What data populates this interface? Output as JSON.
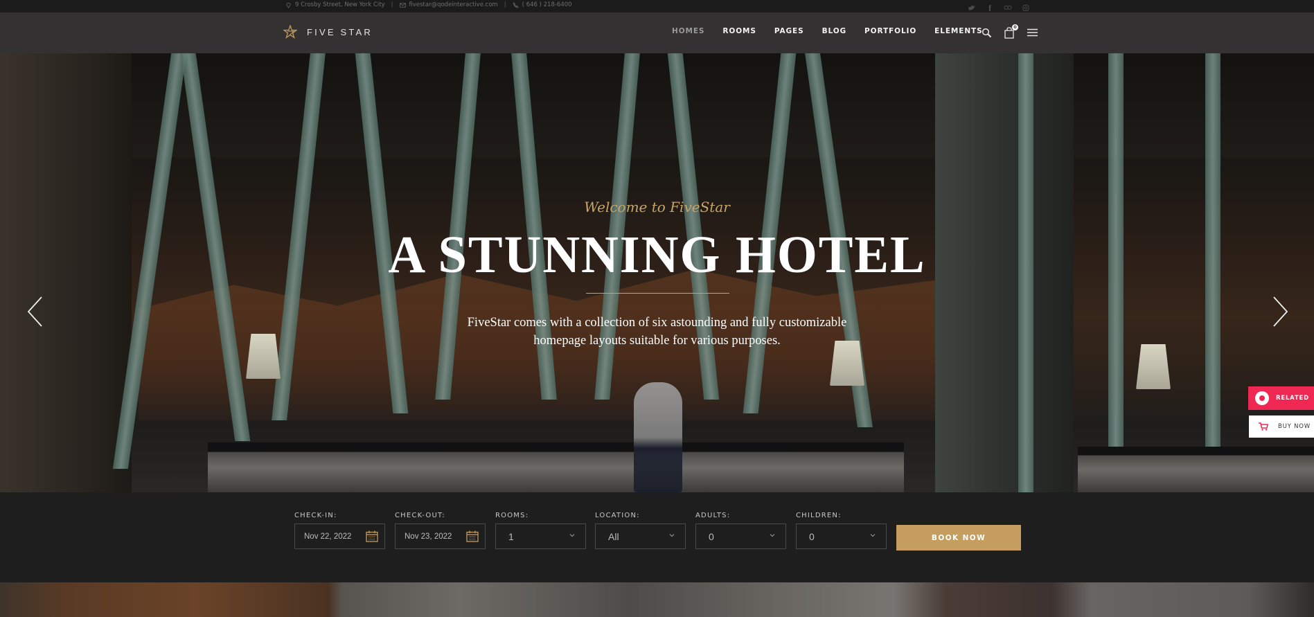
{
  "topbar": {
    "address": "9 Crosby Street, New York City",
    "email": "fivestar@qodeinteractive.com",
    "phone": "( 646 ) 218-6400",
    "separator": "|",
    "social": [
      "twitter-icon",
      "facebook-icon",
      "tripadvisor-icon",
      "instagram-icon"
    ]
  },
  "header": {
    "logo_text": "FIVE STAR",
    "nav": [
      {
        "label": "HOMES",
        "active": true
      },
      {
        "label": "ROOMS",
        "active": false
      },
      {
        "label": "PAGES",
        "active": false
      },
      {
        "label": "BLOG",
        "active": false
      },
      {
        "label": "PORTFOLIO",
        "active": false
      },
      {
        "label": "ELEMENTS",
        "active": false
      }
    ],
    "cart_count": "0"
  },
  "hero": {
    "welcome": "Welcome to FiveStar",
    "headline": "A STUNNING HOTEL",
    "subtitle_line1": "FiveStar comes with a collection of six astounding and fully customizable",
    "subtitle_line2": "homepage layouts suitable for various purposes."
  },
  "side": {
    "related_label": "RELATED",
    "buy_label": "BUY NOW"
  },
  "booking": {
    "checkin_label": "CHECK-IN:",
    "checkin_value": "Nov 22, 2022",
    "checkout_label": "CHECK-OUT:",
    "checkout_value": "Nov 23, 2022",
    "rooms_label": "ROOMS:",
    "rooms_value": "1",
    "location_label": "LOCATION:",
    "location_value": "All",
    "adults_label": "ADULTS:",
    "adults_value": "0",
    "children_label": "CHILDREN:",
    "children_value": "0",
    "book_label": "BOOK NOW"
  },
  "colors": {
    "accent_gold": "#c49d5f",
    "related_pink": "#ee2852",
    "header_bg": "#333132",
    "booking_bg": "#1e1e1e"
  }
}
